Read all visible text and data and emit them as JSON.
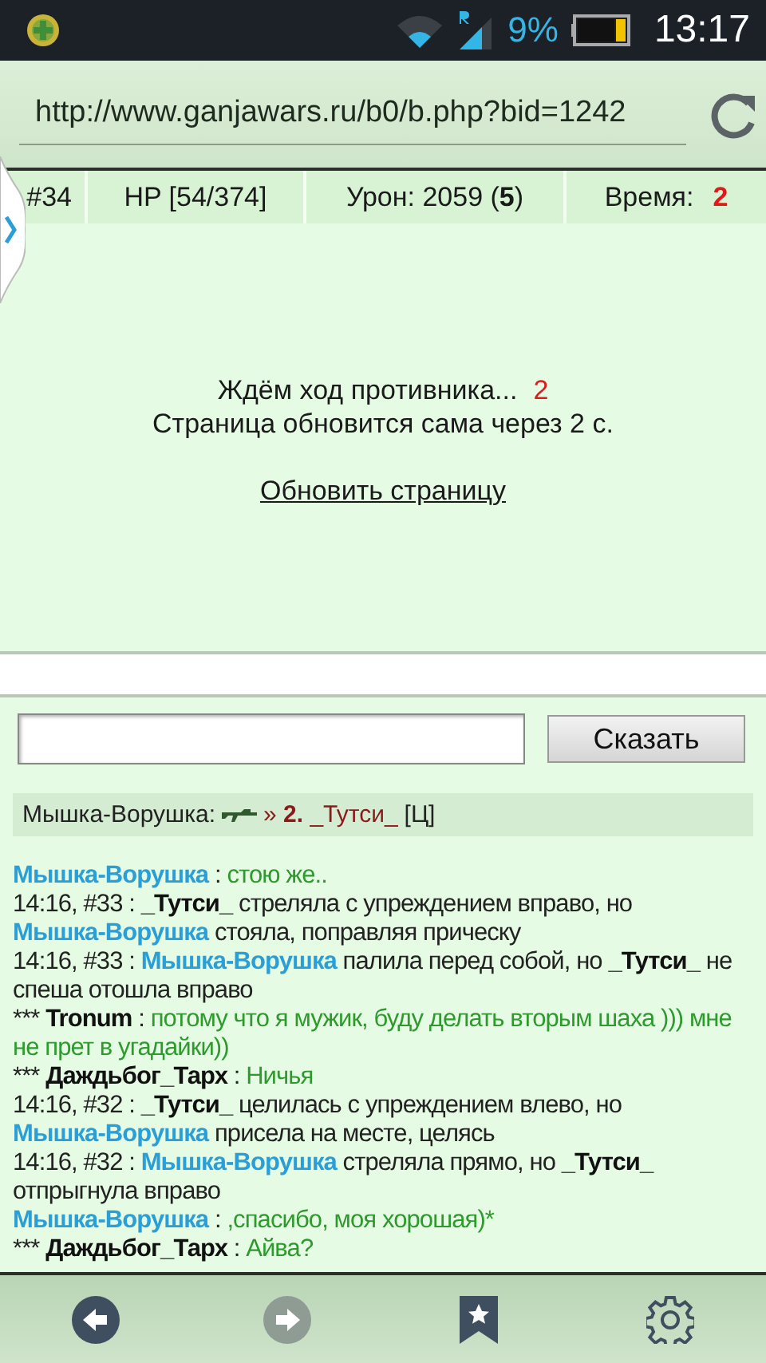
{
  "status_bar": {
    "battery_percent": "9%",
    "time": "13:17"
  },
  "address_bar": {
    "url": "http://www.ganjawars.ru/b0/b.php?bid=1242"
  },
  "battle_stats": {
    "turn": "#34",
    "hp": "HP [54/374]",
    "damage": "Урон: 2059 (**5**)",
    "time_label": "Время:",
    "time_value": "2"
  },
  "wait_panel": {
    "message": "Ждём ход противника...",
    "countdown": "2",
    "note": "Страница обновится сама через 2 с.",
    "refresh_link": "Обновить страницу"
  },
  "chat": {
    "send_button": "Сказать",
    "target": {
      "shooter": "Мышка-Ворушка:",
      "target": "» **2.** _Тутси_",
      "tag": "[Ц]"
    },
    "log": [
      [
        {
          "kind": "player",
          "text": "Мышка-Ворушка"
        },
        {
          "kind": "plain",
          "text": " : "
        },
        {
          "kind": "speech",
          "text": "стою же.."
        }
      ],
      [
        {
          "kind": "plain",
          "text": "14:16, #33 : "
        },
        {
          "kind": "bold",
          "text": "_Тутси_"
        },
        {
          "kind": "plain",
          "text": " стреляла с упреждением вправо, но "
        },
        {
          "kind": "player",
          "text": "Мышка-Ворушка"
        },
        {
          "kind": "plain",
          "text": " стояла, поправляя прическу"
        }
      ],
      [
        {
          "kind": "plain",
          "text": "14:16, #33 : "
        },
        {
          "kind": "player",
          "text": "Мышка-Ворушка"
        },
        {
          "kind": "plain",
          "text": " палила перед собой, но "
        },
        {
          "kind": "bold",
          "text": "_Тутси_"
        },
        {
          "kind": "plain",
          "text": " не спеша отошла вправо"
        }
      ],
      [
        {
          "kind": "plain",
          "text": "*** "
        },
        {
          "kind": "bold",
          "text": "Tronum"
        },
        {
          "kind": "plain",
          "text": " : "
        },
        {
          "kind": "speech",
          "text": "потому что я мужик, буду делать вторым шаха ))) мне не прет в угадайки))"
        }
      ],
      [
        {
          "kind": "plain",
          "text": "*** "
        },
        {
          "kind": "bold",
          "text": "Даждьбог_Тарх"
        },
        {
          "kind": "plain",
          "text": " : "
        },
        {
          "kind": "speech",
          "text": "Ничья"
        }
      ],
      [
        {
          "kind": "plain",
          "text": "14:16, #32 : "
        },
        {
          "kind": "bold",
          "text": "_Тутси_"
        },
        {
          "kind": "plain",
          "text": " целилась с упреждением влево, но "
        },
        {
          "kind": "player",
          "text": "Мышка-Ворушка"
        },
        {
          "kind": "plain",
          "text": " присела на месте, целясь"
        }
      ],
      [
        {
          "kind": "plain",
          "text": "14:16, #32 : "
        },
        {
          "kind": "player",
          "text": "Мышка-Ворушка"
        },
        {
          "kind": "plain",
          "text": " стреляла прямо, но "
        },
        {
          "kind": "bold",
          "text": "_Тутси_"
        },
        {
          "kind": "plain",
          "text": " отпрыгнула вправо"
        }
      ],
      [
        {
          "kind": "player",
          "text": "Мышка-Ворушка"
        },
        {
          "kind": "plain",
          "text": " : "
        },
        {
          "kind": "speech",
          "text": ",спасибо, моя хорошая)*"
        }
      ],
      [
        {
          "kind": "plain",
          "text": "*** "
        },
        {
          "kind": "bold",
          "text": "Даждьбог_Тарх"
        },
        {
          "kind": "plain",
          "text": " : "
        },
        {
          "kind": "speech",
          "text": "Айва?"
        }
      ]
    ]
  },
  "bottom_nav": [
    {
      "kind": "back",
      "disabled": false
    },
    {
      "kind": "forward",
      "disabled": true
    },
    {
      "kind": "bookmarks"
    },
    {
      "kind": "settings"
    }
  ]
}
